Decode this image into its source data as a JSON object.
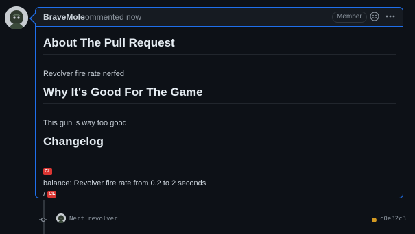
{
  "comment": {
    "author": "BraveMole",
    "meta": "commented now",
    "badge": "Member",
    "sections": [
      {
        "heading": "About The Pull Request",
        "text": "Revolver fire rate nerfed"
      },
      {
        "heading": "Why It's Good For The Game",
        "text": "This gun is way too good"
      },
      {
        "heading": "Changelog",
        "cl_tag": "CL",
        "change_line": "balance: Revolver fire rate from 0.2 to 2 seconds",
        "close_prefix": "/",
        "close_tag": "CL"
      }
    ]
  },
  "commit": {
    "message": "Nerf revolver",
    "sha": "c0e32c3",
    "status_color": "#d29922"
  },
  "colors": {
    "accent": "#1f6feb",
    "background": "#0d1117",
    "cl_tag": "#da3633"
  },
  "icons": {
    "avatar": "avatar-icon",
    "emoji": "smiley-icon",
    "more": "kebab-menu-icon",
    "commit": "git-commit-icon"
  }
}
